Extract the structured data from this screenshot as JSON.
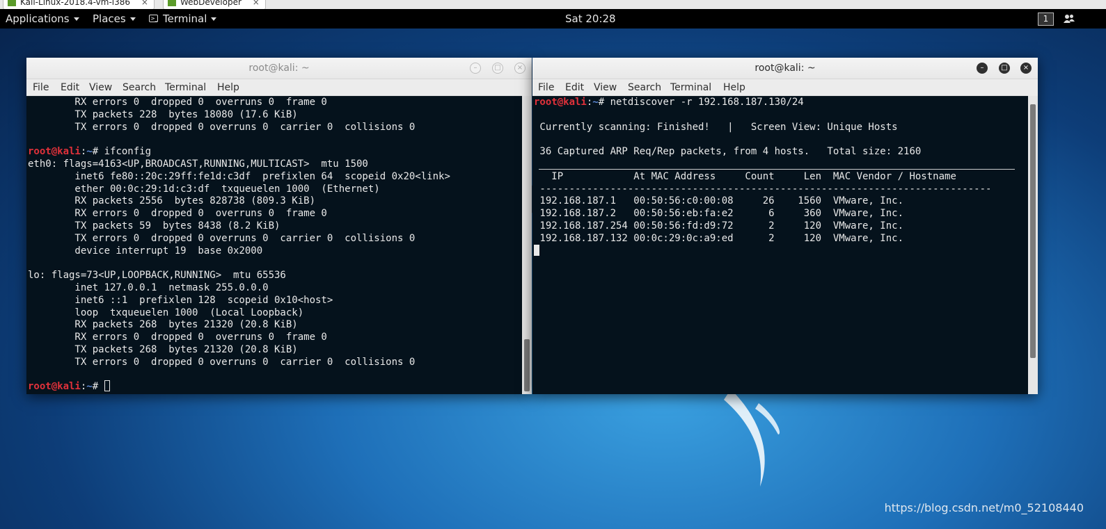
{
  "vm_tabs": [
    {
      "label": "Kali-Linux-2018.4-vm-i386",
      "close": "×"
    },
    {
      "label": "WebDeveloper",
      "close": "×"
    }
  ],
  "topbar": {
    "applications": "Applications",
    "places": "Places",
    "terminal": "Terminal",
    "clock": "Sat 20:28",
    "workspace": "1"
  },
  "left_window": {
    "title": "root@kali: ~",
    "menu": [
      "File",
      "Edit",
      "View",
      "Search",
      "Terminal",
      "Help"
    ],
    "lines": [
      {
        "text": "        RX errors 0  dropped 0  overruns 0  frame 0"
      },
      {
        "text": "        TX packets 228  bytes 18080 (17.6 KiB)"
      },
      {
        "text": "        TX errors 0  dropped 0 overruns 0  carrier 0  collisions 0"
      },
      {
        "text": ""
      },
      {
        "user": "root@kali",
        "path": "~",
        "cmd": "# ifconfig"
      },
      {
        "text": "eth0: flags=4163<UP,BROADCAST,RUNNING,MULTICAST>  mtu 1500"
      },
      {
        "text": "        inet6 fe80::20c:29ff:fe1d:c3df  prefixlen 64  scopeid 0x20<link>"
      },
      {
        "text": "        ether 00:0c:29:1d:c3:df  txqueuelen 1000  (Ethernet)"
      },
      {
        "text": "        RX packets 2556  bytes 828738 (809.3 KiB)"
      },
      {
        "text": "        RX errors 0  dropped 0  overruns 0  frame 0"
      },
      {
        "text": "        TX packets 59  bytes 8438 (8.2 KiB)"
      },
      {
        "text": "        TX errors 0  dropped 0 overruns 0  carrier 0  collisions 0"
      },
      {
        "text": "        device interrupt 19  base 0x2000"
      },
      {
        "text": ""
      },
      {
        "text": "lo: flags=73<UP,LOOPBACK,RUNNING>  mtu 65536"
      },
      {
        "text": "        inet 127.0.0.1  netmask 255.0.0.0"
      },
      {
        "text": "        inet6 ::1  prefixlen 128  scopeid 0x10<host>"
      },
      {
        "text": "        loop  txqueuelen 1000  (Local Loopback)"
      },
      {
        "text": "        RX packets 268  bytes 21320 (20.8 KiB)"
      },
      {
        "text": "        RX errors 0  dropped 0  overruns 0  frame 0"
      },
      {
        "text": "        TX packets 268  bytes 21320 (20.8 KiB)"
      },
      {
        "text": "        TX errors 0  dropped 0 overruns 0  carrier 0  collisions 0"
      },
      {
        "text": ""
      },
      {
        "user": "root@kali",
        "path": "~",
        "cmd": "# ",
        "cursor": "outline"
      }
    ]
  },
  "right_window": {
    "title": "root@kali: ~",
    "menu": [
      "File",
      "Edit",
      "View",
      "Search",
      "Terminal",
      "Help"
    ],
    "lines": [
      {
        "user": "root@kali",
        "path": "~",
        "cmd": "# netdiscover -r 192.168.187.130/24"
      },
      {
        "text": ""
      },
      {
        "text": " Currently scanning: Finished!   |   Screen View: Unique Hosts"
      },
      {
        "text": ""
      },
      {
        "text": " 36 Captured ARP Req/Rep packets, from 4 hosts.   Total size: 2160"
      },
      {
        "text": ""
      },
      {
        "text": "   IP            At MAC Address     Count     Len  MAC Vendor / Hostname"
      },
      {
        "text": " -----------------------------------------------------------------------------"
      },
      {
        "text": " 192.168.187.1   00:50:56:c0:00:08     26    1560  VMware, Inc."
      },
      {
        "text": " 192.168.187.2   00:50:56:eb:fa:e2      6     360  VMware, Inc."
      },
      {
        "text": " 192.168.187.254 00:50:56:fd:d9:72      2     120  VMware, Inc."
      },
      {
        "text": " 192.168.187.132 00:0c:29:0c:a9:ed      2     120  VMware, Inc."
      },
      {
        "text": "",
        "cursor": "solid"
      }
    ]
  },
  "watermark": "https://blog.csdn.net/m0_52108440"
}
